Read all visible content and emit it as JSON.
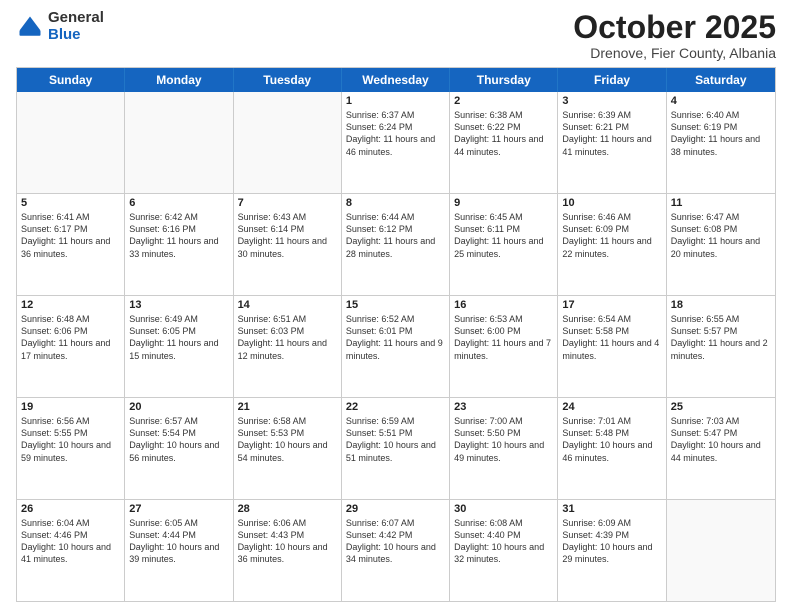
{
  "header": {
    "logo_general": "General",
    "logo_blue": "Blue",
    "month_title": "October 2025",
    "subtitle": "Drenove, Fier County, Albania"
  },
  "weekdays": [
    "Sunday",
    "Monday",
    "Tuesday",
    "Wednesday",
    "Thursday",
    "Friday",
    "Saturday"
  ],
  "weeks": [
    [
      {
        "day": "",
        "sunrise": "",
        "sunset": "",
        "daylight": "",
        "empty": true
      },
      {
        "day": "",
        "sunrise": "",
        "sunset": "",
        "daylight": "",
        "empty": true
      },
      {
        "day": "",
        "sunrise": "",
        "sunset": "",
        "daylight": "",
        "empty": true
      },
      {
        "day": "1",
        "sunrise": "Sunrise: 6:37 AM",
        "sunset": "Sunset: 6:24 PM",
        "daylight": "Daylight: 11 hours and 46 minutes.",
        "empty": false
      },
      {
        "day": "2",
        "sunrise": "Sunrise: 6:38 AM",
        "sunset": "Sunset: 6:22 PM",
        "daylight": "Daylight: 11 hours and 44 minutes.",
        "empty": false
      },
      {
        "day": "3",
        "sunrise": "Sunrise: 6:39 AM",
        "sunset": "Sunset: 6:21 PM",
        "daylight": "Daylight: 11 hours and 41 minutes.",
        "empty": false
      },
      {
        "day": "4",
        "sunrise": "Sunrise: 6:40 AM",
        "sunset": "Sunset: 6:19 PM",
        "daylight": "Daylight: 11 hours and 38 minutes.",
        "empty": false
      }
    ],
    [
      {
        "day": "5",
        "sunrise": "Sunrise: 6:41 AM",
        "sunset": "Sunset: 6:17 PM",
        "daylight": "Daylight: 11 hours and 36 minutes.",
        "empty": false
      },
      {
        "day": "6",
        "sunrise": "Sunrise: 6:42 AM",
        "sunset": "Sunset: 6:16 PM",
        "daylight": "Daylight: 11 hours and 33 minutes.",
        "empty": false
      },
      {
        "day": "7",
        "sunrise": "Sunrise: 6:43 AM",
        "sunset": "Sunset: 6:14 PM",
        "daylight": "Daylight: 11 hours and 30 minutes.",
        "empty": false
      },
      {
        "day": "8",
        "sunrise": "Sunrise: 6:44 AM",
        "sunset": "Sunset: 6:12 PM",
        "daylight": "Daylight: 11 hours and 28 minutes.",
        "empty": false
      },
      {
        "day": "9",
        "sunrise": "Sunrise: 6:45 AM",
        "sunset": "Sunset: 6:11 PM",
        "daylight": "Daylight: 11 hours and 25 minutes.",
        "empty": false
      },
      {
        "day": "10",
        "sunrise": "Sunrise: 6:46 AM",
        "sunset": "Sunset: 6:09 PM",
        "daylight": "Daylight: 11 hours and 22 minutes.",
        "empty": false
      },
      {
        "day": "11",
        "sunrise": "Sunrise: 6:47 AM",
        "sunset": "Sunset: 6:08 PM",
        "daylight": "Daylight: 11 hours and 20 minutes.",
        "empty": false
      }
    ],
    [
      {
        "day": "12",
        "sunrise": "Sunrise: 6:48 AM",
        "sunset": "Sunset: 6:06 PM",
        "daylight": "Daylight: 11 hours and 17 minutes.",
        "empty": false
      },
      {
        "day": "13",
        "sunrise": "Sunrise: 6:49 AM",
        "sunset": "Sunset: 6:05 PM",
        "daylight": "Daylight: 11 hours and 15 minutes.",
        "empty": false
      },
      {
        "day": "14",
        "sunrise": "Sunrise: 6:51 AM",
        "sunset": "Sunset: 6:03 PM",
        "daylight": "Daylight: 11 hours and 12 minutes.",
        "empty": false
      },
      {
        "day": "15",
        "sunrise": "Sunrise: 6:52 AM",
        "sunset": "Sunset: 6:01 PM",
        "daylight": "Daylight: 11 hours and 9 minutes.",
        "empty": false
      },
      {
        "day": "16",
        "sunrise": "Sunrise: 6:53 AM",
        "sunset": "Sunset: 6:00 PM",
        "daylight": "Daylight: 11 hours and 7 minutes.",
        "empty": false
      },
      {
        "day": "17",
        "sunrise": "Sunrise: 6:54 AM",
        "sunset": "Sunset: 5:58 PM",
        "daylight": "Daylight: 11 hours and 4 minutes.",
        "empty": false
      },
      {
        "day": "18",
        "sunrise": "Sunrise: 6:55 AM",
        "sunset": "Sunset: 5:57 PM",
        "daylight": "Daylight: 11 hours and 2 minutes.",
        "empty": false
      }
    ],
    [
      {
        "day": "19",
        "sunrise": "Sunrise: 6:56 AM",
        "sunset": "Sunset: 5:55 PM",
        "daylight": "Daylight: 10 hours and 59 minutes.",
        "empty": false
      },
      {
        "day": "20",
        "sunrise": "Sunrise: 6:57 AM",
        "sunset": "Sunset: 5:54 PM",
        "daylight": "Daylight: 10 hours and 56 minutes.",
        "empty": false
      },
      {
        "day": "21",
        "sunrise": "Sunrise: 6:58 AM",
        "sunset": "Sunset: 5:53 PM",
        "daylight": "Daylight: 10 hours and 54 minutes.",
        "empty": false
      },
      {
        "day": "22",
        "sunrise": "Sunrise: 6:59 AM",
        "sunset": "Sunset: 5:51 PM",
        "daylight": "Daylight: 10 hours and 51 minutes.",
        "empty": false
      },
      {
        "day": "23",
        "sunrise": "Sunrise: 7:00 AM",
        "sunset": "Sunset: 5:50 PM",
        "daylight": "Daylight: 10 hours and 49 minutes.",
        "empty": false
      },
      {
        "day": "24",
        "sunrise": "Sunrise: 7:01 AM",
        "sunset": "Sunset: 5:48 PM",
        "daylight": "Daylight: 10 hours and 46 minutes.",
        "empty": false
      },
      {
        "day": "25",
        "sunrise": "Sunrise: 7:03 AM",
        "sunset": "Sunset: 5:47 PM",
        "daylight": "Daylight: 10 hours and 44 minutes.",
        "empty": false
      }
    ],
    [
      {
        "day": "26",
        "sunrise": "Sunrise: 6:04 AM",
        "sunset": "Sunset: 4:46 PM",
        "daylight": "Daylight: 10 hours and 41 minutes.",
        "empty": false
      },
      {
        "day": "27",
        "sunrise": "Sunrise: 6:05 AM",
        "sunset": "Sunset: 4:44 PM",
        "daylight": "Daylight: 10 hours and 39 minutes.",
        "empty": false
      },
      {
        "day": "28",
        "sunrise": "Sunrise: 6:06 AM",
        "sunset": "Sunset: 4:43 PM",
        "daylight": "Daylight: 10 hours and 36 minutes.",
        "empty": false
      },
      {
        "day": "29",
        "sunrise": "Sunrise: 6:07 AM",
        "sunset": "Sunset: 4:42 PM",
        "daylight": "Daylight: 10 hours and 34 minutes.",
        "empty": false
      },
      {
        "day": "30",
        "sunrise": "Sunrise: 6:08 AM",
        "sunset": "Sunset: 4:40 PM",
        "daylight": "Daylight: 10 hours and 32 minutes.",
        "empty": false
      },
      {
        "day": "31",
        "sunrise": "Sunrise: 6:09 AM",
        "sunset": "Sunset: 4:39 PM",
        "daylight": "Daylight: 10 hours and 29 minutes.",
        "empty": false
      },
      {
        "day": "",
        "sunrise": "",
        "sunset": "",
        "daylight": "",
        "empty": true
      }
    ]
  ]
}
